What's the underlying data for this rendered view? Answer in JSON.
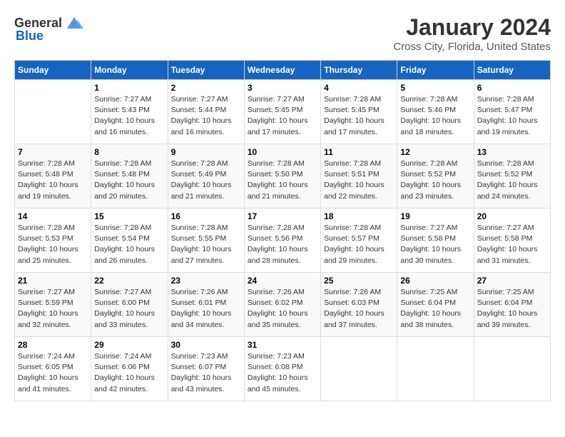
{
  "header": {
    "logo_general": "General",
    "logo_blue": "Blue",
    "title": "January 2024",
    "subtitle": "Cross City, Florida, United States"
  },
  "days_of_week": [
    "Sunday",
    "Monday",
    "Tuesday",
    "Wednesday",
    "Thursday",
    "Friday",
    "Saturday"
  ],
  "weeks": [
    [
      {
        "day": "",
        "info": ""
      },
      {
        "day": "1",
        "info": "Sunrise: 7:27 AM\nSunset: 5:43 PM\nDaylight: 10 hours\nand 16 minutes."
      },
      {
        "day": "2",
        "info": "Sunrise: 7:27 AM\nSunset: 5:44 PM\nDaylight: 10 hours\nand 16 minutes."
      },
      {
        "day": "3",
        "info": "Sunrise: 7:27 AM\nSunset: 5:45 PM\nDaylight: 10 hours\nand 17 minutes."
      },
      {
        "day": "4",
        "info": "Sunrise: 7:28 AM\nSunset: 5:45 PM\nDaylight: 10 hours\nand 17 minutes."
      },
      {
        "day": "5",
        "info": "Sunrise: 7:28 AM\nSunset: 5:46 PM\nDaylight: 10 hours\nand 18 minutes."
      },
      {
        "day": "6",
        "info": "Sunrise: 7:28 AM\nSunset: 5:47 PM\nDaylight: 10 hours\nand 19 minutes."
      }
    ],
    [
      {
        "day": "7",
        "info": "Sunrise: 7:28 AM\nSunset: 5:48 PM\nDaylight: 10 hours\nand 19 minutes."
      },
      {
        "day": "8",
        "info": "Sunrise: 7:28 AM\nSunset: 5:48 PM\nDaylight: 10 hours\nand 20 minutes."
      },
      {
        "day": "9",
        "info": "Sunrise: 7:28 AM\nSunset: 5:49 PM\nDaylight: 10 hours\nand 21 minutes."
      },
      {
        "day": "10",
        "info": "Sunrise: 7:28 AM\nSunset: 5:50 PM\nDaylight: 10 hours\nand 21 minutes."
      },
      {
        "day": "11",
        "info": "Sunrise: 7:28 AM\nSunset: 5:51 PM\nDaylight: 10 hours\nand 22 minutes."
      },
      {
        "day": "12",
        "info": "Sunrise: 7:28 AM\nSunset: 5:52 PM\nDaylight: 10 hours\nand 23 minutes."
      },
      {
        "day": "13",
        "info": "Sunrise: 7:28 AM\nSunset: 5:52 PM\nDaylight: 10 hours\nand 24 minutes."
      }
    ],
    [
      {
        "day": "14",
        "info": "Sunrise: 7:28 AM\nSunset: 5:53 PM\nDaylight: 10 hours\nand 25 minutes."
      },
      {
        "day": "15",
        "info": "Sunrise: 7:28 AM\nSunset: 5:54 PM\nDaylight: 10 hours\nand 26 minutes."
      },
      {
        "day": "16",
        "info": "Sunrise: 7:28 AM\nSunset: 5:55 PM\nDaylight: 10 hours\nand 27 minutes."
      },
      {
        "day": "17",
        "info": "Sunrise: 7:28 AM\nSunset: 5:56 PM\nDaylight: 10 hours\nand 28 minutes."
      },
      {
        "day": "18",
        "info": "Sunrise: 7:28 AM\nSunset: 5:57 PM\nDaylight: 10 hours\nand 29 minutes."
      },
      {
        "day": "19",
        "info": "Sunrise: 7:27 AM\nSunset: 5:58 PM\nDaylight: 10 hours\nand 30 minutes."
      },
      {
        "day": "20",
        "info": "Sunrise: 7:27 AM\nSunset: 5:58 PM\nDaylight: 10 hours\nand 31 minutes."
      }
    ],
    [
      {
        "day": "21",
        "info": "Sunrise: 7:27 AM\nSunset: 5:59 PM\nDaylight: 10 hours\nand 32 minutes."
      },
      {
        "day": "22",
        "info": "Sunrise: 7:27 AM\nSunset: 6:00 PM\nDaylight: 10 hours\nand 33 minutes."
      },
      {
        "day": "23",
        "info": "Sunrise: 7:26 AM\nSunset: 6:01 PM\nDaylight: 10 hours\nand 34 minutes."
      },
      {
        "day": "24",
        "info": "Sunrise: 7:26 AM\nSunset: 6:02 PM\nDaylight: 10 hours\nand 35 minutes."
      },
      {
        "day": "25",
        "info": "Sunrise: 7:26 AM\nSunset: 6:03 PM\nDaylight: 10 hours\nand 37 minutes."
      },
      {
        "day": "26",
        "info": "Sunrise: 7:25 AM\nSunset: 6:04 PM\nDaylight: 10 hours\nand 38 minutes."
      },
      {
        "day": "27",
        "info": "Sunrise: 7:25 AM\nSunset: 6:04 PM\nDaylight: 10 hours\nand 39 minutes."
      }
    ],
    [
      {
        "day": "28",
        "info": "Sunrise: 7:24 AM\nSunset: 6:05 PM\nDaylight: 10 hours\nand 41 minutes."
      },
      {
        "day": "29",
        "info": "Sunrise: 7:24 AM\nSunset: 6:06 PM\nDaylight: 10 hours\nand 42 minutes."
      },
      {
        "day": "30",
        "info": "Sunrise: 7:23 AM\nSunset: 6:07 PM\nDaylight: 10 hours\nand 43 minutes."
      },
      {
        "day": "31",
        "info": "Sunrise: 7:23 AM\nSunset: 6:08 PM\nDaylight: 10 hours\nand 45 minutes."
      },
      {
        "day": "",
        "info": ""
      },
      {
        "day": "",
        "info": ""
      },
      {
        "day": "",
        "info": ""
      }
    ]
  ]
}
